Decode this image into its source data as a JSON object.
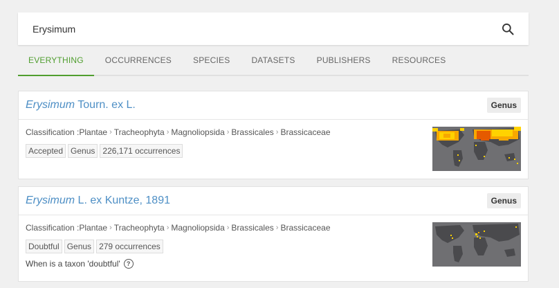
{
  "search": {
    "value": "Erysimum",
    "icon": "search-icon"
  },
  "tabs": [
    {
      "label": "EVERYTHING",
      "active": true
    },
    {
      "label": "OCCURRENCES",
      "active": false
    },
    {
      "label": "SPECIES",
      "active": false
    },
    {
      "label": "DATASETS",
      "active": false
    },
    {
      "label": "PUBLISHERS",
      "active": false
    },
    {
      "label": "RESOURCES",
      "active": false
    }
  ],
  "results": [
    {
      "title_italic": "Erysimum",
      "title_rest": " Tourn. ex L.",
      "rank": "Genus",
      "classification_label": "Classification : ",
      "classification": [
        "Plantae",
        "Tracheophyta",
        "Magnoliopsida",
        "Brassicales",
        "Brassicaceae"
      ],
      "tags": [
        "Accepted",
        "Genus",
        "226,171 occurrences"
      ],
      "help": null
    },
    {
      "title_italic": "Erysimum",
      "title_rest": " L. ex Kuntze, 1891",
      "rank": "Genus",
      "classification_label": "Classification : ",
      "classification": [
        "Plantae",
        "Tracheophyta",
        "Magnoliopsida",
        "Brassicales",
        "Brassicaceae"
      ],
      "tags": [
        "Doubtful",
        "Genus",
        "279 occurrences"
      ],
      "help": "When is a taxon 'doubtful'"
    }
  ],
  "colors": {
    "accent": "#509e2f",
    "link": "#4e8fc5",
    "background": "#f0f0f0",
    "map_ocean": "#6f6f72",
    "map_land": "#4a4a4d",
    "map_high": "#f7a800",
    "map_mid": "#ffd200",
    "map_hot": "#e55a00"
  }
}
